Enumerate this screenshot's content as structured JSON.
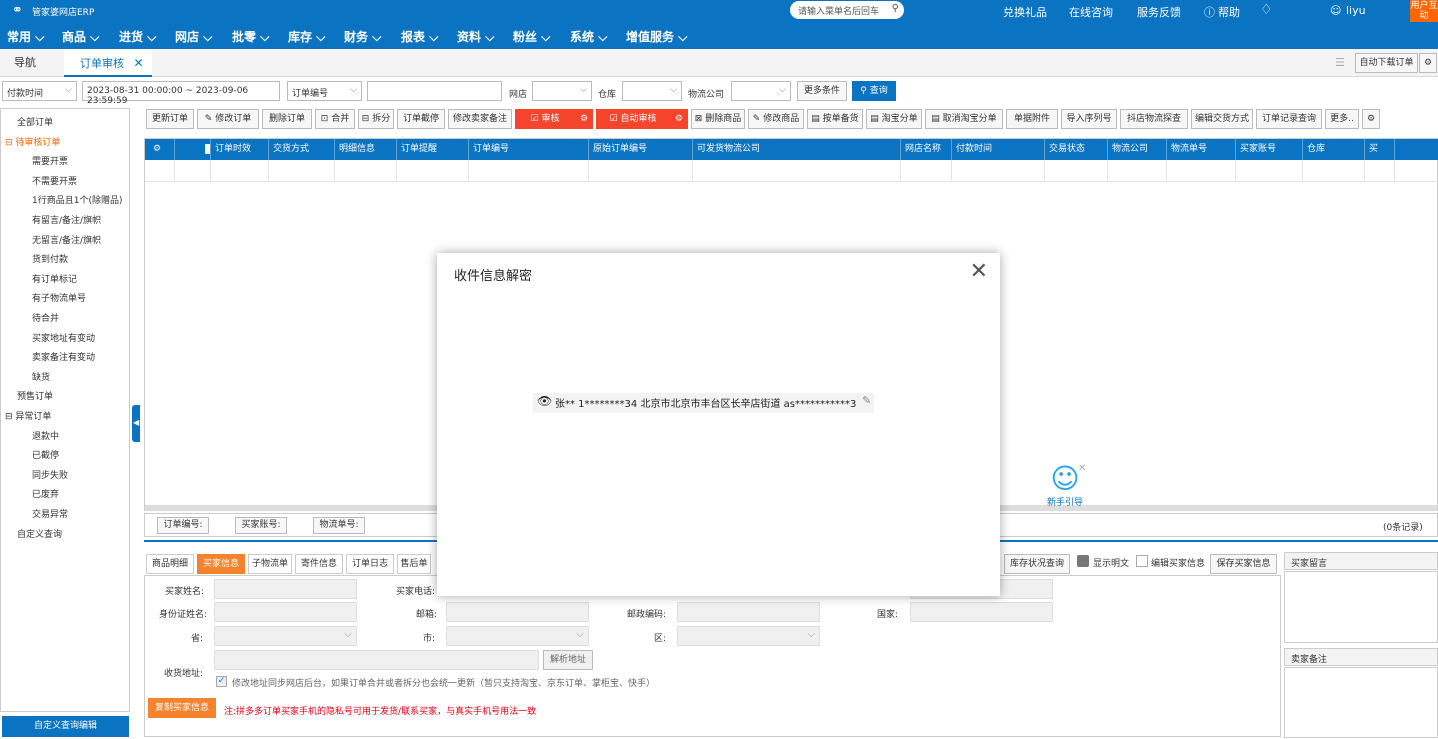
{
  "topbar": {
    "logo": "管家婆网店ERP",
    "search_placeholder": "请输入菜单名后回车",
    "links": [
      "兑换礼品",
      "在线咨询",
      "服务反馈",
      "帮助"
    ],
    "user": "liyu",
    "badge": "用户互动"
  },
  "menu": [
    "常用",
    "商品",
    "进货",
    "网店",
    "批零",
    "库存",
    "财务",
    "报表",
    "资料",
    "粉丝",
    "系统",
    "增值服务"
  ],
  "tabs": {
    "nav": "导航",
    "active": "订单审核",
    "auto_download": "自动下载订单"
  },
  "filters": {
    "time_type": "付款时间",
    "date_range": "2023-08-31 00:00:00 ~ 2023-09-06 23:59:59",
    "order_field": "订单编号",
    "shop_label": "网店",
    "warehouse_label": "仓库",
    "logistics_label": "物流公司",
    "more": "更多条件",
    "query": "查询"
  },
  "sidebar": {
    "items": [
      {
        "label": "全部订单",
        "indent": 0
      },
      {
        "label": "⊟ 待审核订单",
        "indent": 0,
        "active": true
      },
      {
        "label": "需要开票",
        "indent": 1
      },
      {
        "label": "不需要开票",
        "indent": 1
      },
      {
        "label": "1行商品且1个(除赠品)",
        "indent": 1
      },
      {
        "label": "有留言/备注/旗帜",
        "indent": 1
      },
      {
        "label": "无留言/备注/旗帜",
        "indent": 1
      },
      {
        "label": "货到付款",
        "indent": 1
      },
      {
        "label": "有订单标记",
        "indent": 1
      },
      {
        "label": "有子物流单号",
        "indent": 1
      },
      {
        "label": "待合并",
        "indent": 1
      },
      {
        "label": "买家地址有变动",
        "indent": 1
      },
      {
        "label": "卖家备注有变动",
        "indent": 1
      },
      {
        "label": "缺货",
        "indent": 1
      },
      {
        "label": "预售订单",
        "indent": 0
      },
      {
        "label": "⊟ 异常订单",
        "indent": 0
      },
      {
        "label": "退款中",
        "indent": 1
      },
      {
        "label": "已截停",
        "indent": 1
      },
      {
        "label": "同步失败",
        "indent": 1
      },
      {
        "label": "已废弃",
        "indent": 1
      },
      {
        "label": "交易异常",
        "indent": 1
      },
      {
        "label": "自定义查询",
        "indent": 0
      }
    ],
    "bottom_button": "自定义查询编辑"
  },
  "actions": [
    "更新订单",
    "修改订单",
    "删除订单",
    "合并",
    "拆分",
    "订单截停",
    "修改卖家备注",
    "审核",
    "自动审核",
    "删除商品",
    "修改商品",
    "按单备货",
    "淘宝分单",
    "取消淘宝分单",
    "单据附件",
    "导入序列号",
    "抖店物流探查",
    "编辑交货方式",
    "订单记录查询",
    "更多.."
  ],
  "grid": {
    "columns": [
      "",
      "",
      "订单时效",
      "交货方式",
      "明细信息",
      "订单提醒",
      "订单编号",
      "原始订单编号",
      "可发货物流公司",
      "网店名称",
      "付款时间",
      "交易状态",
      "物流公司",
      "物流单号",
      "买家账号",
      "仓库",
      "买"
    ],
    "footer": {
      "order_no": "订单编号:",
      "buyer": "买家账号:",
      "logistics_no": "物流单号:",
      "count": "(0条记录)"
    }
  },
  "bottom": {
    "tabs": [
      "商品明细",
      "买家信息",
      "子物流单",
      "寄件信息",
      "订单日志",
      "售后单"
    ],
    "right_buttons": {
      "stock": "库存状况查询",
      "show_plain": "显示明文",
      "edit_buyer": "编辑买家信息",
      "save_buyer": "保存买家信息"
    },
    "fields": {
      "buyer_name": "买家姓名:",
      "buyer_phone": "买家电话:",
      "id_name": "身份证姓名:",
      "email": "邮箱:",
      "postcode": "邮政编码:",
      "country": "国家:",
      "province": "省:",
      "city": "市:",
      "district": "区:",
      "address": "收货地址:",
      "parse": "解析地址"
    },
    "sync_note": "修改地址同步网店后台，如果订单合并或者拆分也会统一更新（暂只支持淘宝、京东订单、掌柜宝、快手）",
    "copy_button": "复制买家信息",
    "warning": "注:拼多多订单买家手机的隐私号可用于发货/联系买家，与真实手机号用法一致",
    "buyer_message": "买家留言",
    "seller_note": "卖家备注"
  },
  "modal": {
    "title": "收件信息解密",
    "content": "张** 1********34 北京市北京市丰台区长辛店街道 as***********3"
  },
  "helper": "新手引导"
}
